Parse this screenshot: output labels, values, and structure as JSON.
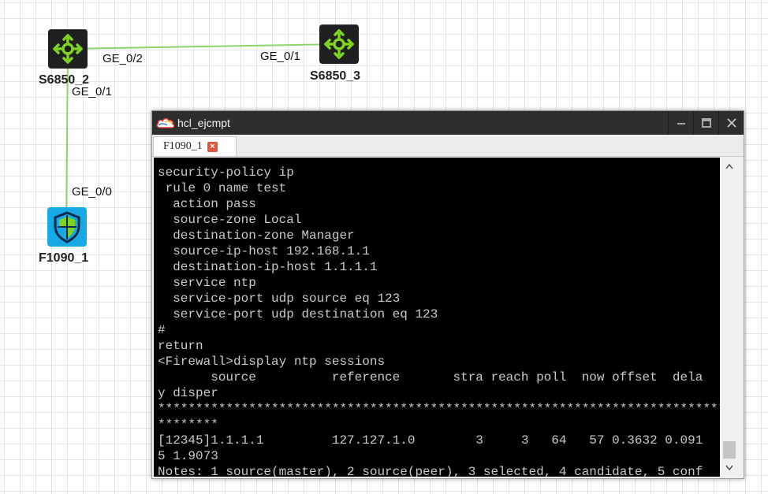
{
  "topology": {
    "devices": [
      {
        "name": "S6850_2",
        "icon": "switch-icon"
      },
      {
        "name": "S6850_3",
        "icon": "switch-icon"
      },
      {
        "name": "F1090_1",
        "icon": "firewall-icon"
      }
    ],
    "ports": {
      "s2_to_s3": "GE_0/2",
      "s3_to_s2": "GE_0/1",
      "s2_to_f1": "GE_0/1",
      "f1_to_s2": "GE_0/0"
    },
    "colors": {
      "link": "#8fd46b",
      "switch_bg": "#1f1f1f",
      "arrow": "#7ed321",
      "firewall_bg": "#16a9e6"
    }
  },
  "terminal": {
    "title": "hcl_ejcmpt",
    "app_icon": "cloud-icon",
    "controls": {
      "minimize": "─",
      "maximize": "☐",
      "close": "✕"
    },
    "tab": {
      "label": "F1090_1",
      "close_glyph": "×"
    },
    "lines": [
      "security-policy ip",
      " rule 0 name test",
      "  action pass",
      "  source-zone Local",
      "  destination-zone Manager",
      "  source-ip-host 192.168.1.1",
      "  destination-ip-host 1.1.1.1",
      "  service ntp",
      "  service-port udp source eq 123",
      "  service-port udp destination eq 123",
      "#",
      "return",
      "<Firewall>display ntp sessions",
      "       source          reference       stra reach poll  now offset  dela",
      "y disper",
      "********************************************************************************",
      "********",
      "[12345]1.1.1.1         127.127.1.0        3     3   64   57 0.3632 0.091",
      "5 1.9073",
      "Notes: 1 source(master), 2 source(peer), 3 selected, 4 candidate, 5 conf"
    ]
  }
}
